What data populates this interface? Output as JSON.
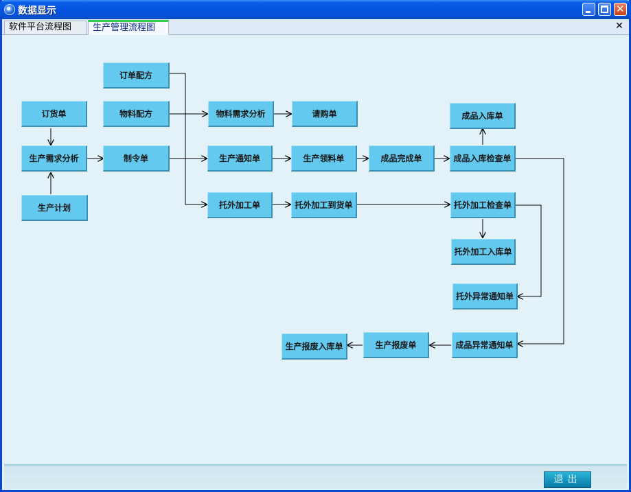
{
  "window": {
    "title": "数据显示"
  },
  "tabs": [
    {
      "label": "软件平台流程图"
    },
    {
      "label": "生产管理流程图"
    }
  ],
  "tab_close_glyph": "✕",
  "flow": {
    "nodes": {
      "order_formula": "订单配方",
      "material_formula": "物料配方",
      "purchase_order": "订货单",
      "demand_analysis": "生产需求分析",
      "production_plan": "生产计划",
      "production_order": "制令单",
      "material_demand_analysis": "物料需求分析",
      "purchase_request": "请购单",
      "production_notice": "生产通知单",
      "material_requisition": "生产领料单",
      "finished_complete": "成品完成单",
      "finished_inspection": "成品入库检查单",
      "finished_inbound": "成品入库单",
      "outsource_order": "托外加工单",
      "outsource_arrival": "托外加工到货单",
      "outsource_inspection": "托外加工检查单",
      "outsource_inbound": "托外加工入库单",
      "outsource_exception": "托外异常通知单",
      "finished_exception": "成品异常通知单",
      "scrap_order": "生产报废单",
      "scrap_inbound": "生产报废入库单"
    }
  },
  "footer": {
    "exit_label": "退出"
  },
  "colors": {
    "node_fill": "#63c9ef",
    "canvas_bg": "#e3f2f8",
    "titlebar": "#0554e0"
  }
}
